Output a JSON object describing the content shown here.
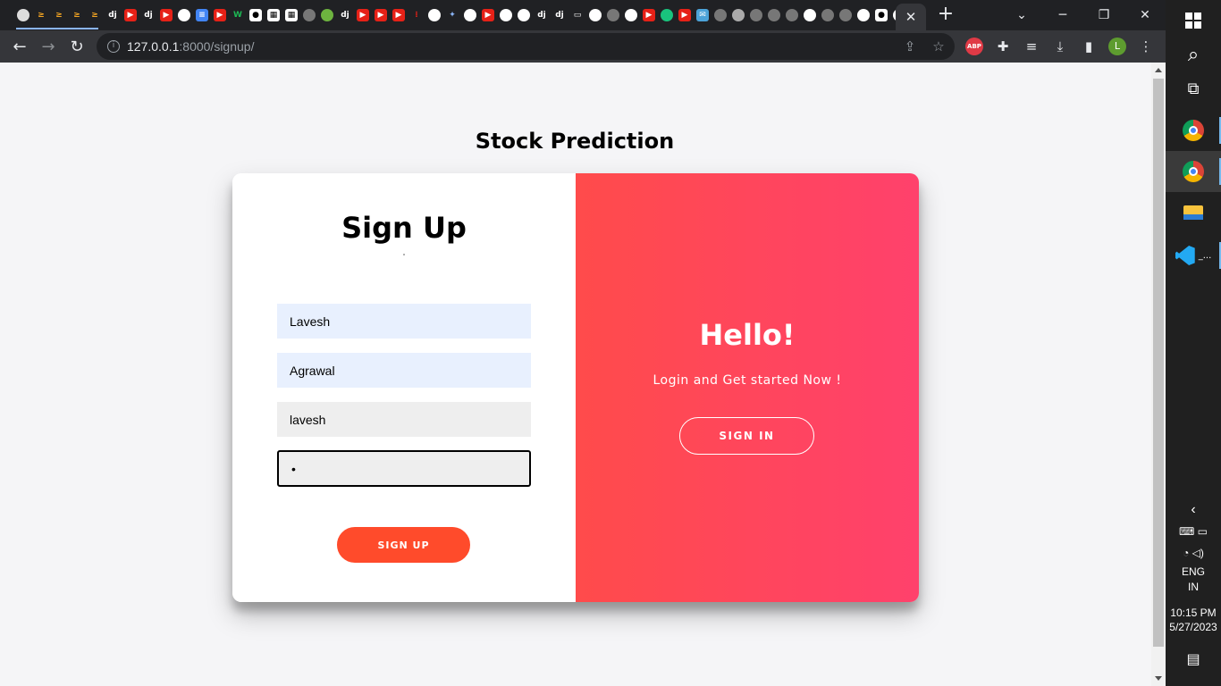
{
  "browser": {
    "url_host": "127.0.0.1",
    "url_rest": ":8000/signup/",
    "active_tab_close": "✕",
    "new_tab": "+",
    "profile_initial": "L",
    "abp_label": "ABP",
    "tab_icons": [
      "circle",
      "amp",
      "amp",
      "amp",
      "amp",
      "dj",
      "yt",
      "dj",
      "yt",
      "gh",
      "docs",
      "yt",
      "w",
      "m",
      "pf",
      "pf",
      "globe",
      "leaf",
      "dj",
      "yt",
      "yt",
      "yt",
      "dots",
      "g",
      "spark",
      "g",
      "yt",
      "gh",
      "gh",
      "dj",
      "dj",
      "win",
      "g",
      "globe",
      "gh",
      "yt",
      "gpt",
      "yt",
      "mail",
      "globe",
      "db",
      "globe",
      "globe",
      "globe",
      "chrome",
      "globe",
      "globe",
      "gh",
      "m",
      "gh",
      "yt"
    ]
  },
  "page": {
    "title": "Stock Prediction",
    "form": {
      "heading": "Sign Up",
      "first_name": "Lavesh",
      "last_name": "Agrawal",
      "username": "lavesh",
      "password": "•",
      "submit_label": "SIGN UP"
    },
    "overlay": {
      "heading": "Hello!",
      "subtitle": "Login and Get started Now !",
      "button_label": "SIGN IN"
    }
  },
  "taskbar": {
    "vscode_label": "_...",
    "language": "ENG",
    "region": "IN",
    "time": "10:15 PM",
    "date": "5/27/2023"
  }
}
